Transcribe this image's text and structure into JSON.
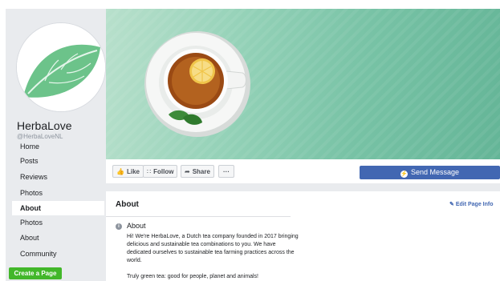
{
  "page": {
    "name": "HerbaLove",
    "handle": "@HerbaLoveNL"
  },
  "sidebar": {
    "items": [
      {
        "label": "Home"
      },
      {
        "label": "Posts"
      },
      {
        "label": "Reviews"
      },
      {
        "label": "Photos"
      },
      {
        "label": "About"
      },
      {
        "label": "Photos"
      },
      {
        "label": "About"
      },
      {
        "label": "Community"
      }
    ],
    "active_item": "About",
    "create_page_label": "Create a Page"
  },
  "actions": {
    "like_label": "Like",
    "follow_label": "Follow",
    "share_label": "Share",
    "more_label": "···",
    "send_message_label": "Send Message"
  },
  "about": {
    "heading": "About",
    "edit_label": "Edit Page Info",
    "section_title": "About",
    "description": "Hi! We're HerbaLove, a Dutch tea company founded in 2017 bringing delicious and sustainable tea combinations to you. We have dedicated ourselves to sustainable tea farming practices across the world.",
    "tagline": "Truly green tea: good for people, planet and animals!"
  },
  "icons": {
    "like": "thumbs-up-icon",
    "follow": "rss-icon",
    "share": "share-arrow-icon",
    "send": "messenger-icon",
    "edit": "pencil-icon",
    "info": "info-icon"
  },
  "colors": {
    "brand_blue": "#4267b2",
    "create_green": "#42b72a",
    "sidebar_bg": "#e9ebee",
    "cover_green": "#8fd0b5"
  }
}
